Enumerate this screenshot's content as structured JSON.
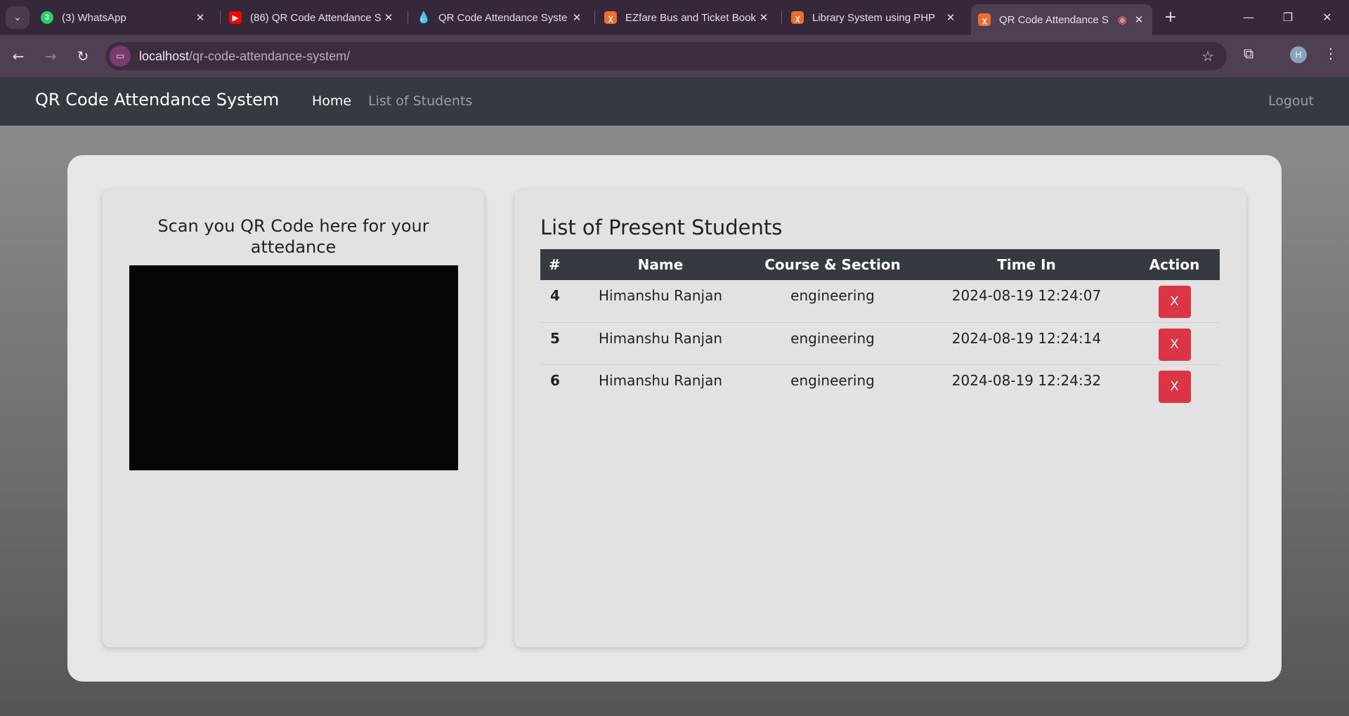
{
  "browser": {
    "tabs": [
      {
        "title": "(3) WhatsApp",
        "badge": "3",
        "icon": "whatsapp-icon",
        "color": "#25d366"
      },
      {
        "title": "(86) QR Code Attendance S",
        "icon": "youtube-icon",
        "color": "#ff0000"
      },
      {
        "title": "QR Code Attendance Syste",
        "icon": "drupal-icon",
        "color": "#0b8ed8"
      },
      {
        "title": "EZfare Bus and Ticket Book",
        "icon": "xampp-icon",
        "color": "#f26c2b"
      },
      {
        "title": "Library System using PHP",
        "icon": "xampp-icon",
        "color": "#f26c2b"
      },
      {
        "title": "QR Code Attendance S",
        "icon": "xampp-icon",
        "color": "#f26c2b"
      }
    ],
    "url_host": "localhost",
    "url_path": "/qr-code-attendance-system/",
    "profile_initial": "H"
  },
  "nav": {
    "brand": "QR Code Attendance System",
    "home": "Home",
    "students": "List of Students",
    "logout": "Logout"
  },
  "scan": {
    "title": "Scan you QR Code here for your attedance"
  },
  "attendance": {
    "title": "List of Present Students",
    "columns": [
      "#",
      "Name",
      "Course & Section",
      "Time In",
      "Action"
    ],
    "rows": [
      {
        "id": "4",
        "name": "Himanshu Ranjan",
        "course": "engineering",
        "time_in": "2024-08-19 12:24:07",
        "action": "X"
      },
      {
        "id": "5",
        "name": "Himanshu Ranjan",
        "course": "engineering",
        "time_in": "2024-08-19 12:24:14",
        "action": "X"
      },
      {
        "id": "6",
        "name": "Himanshu Ranjan",
        "course": "engineering",
        "time_in": "2024-08-19 12:24:32",
        "action": "X"
      }
    ]
  }
}
